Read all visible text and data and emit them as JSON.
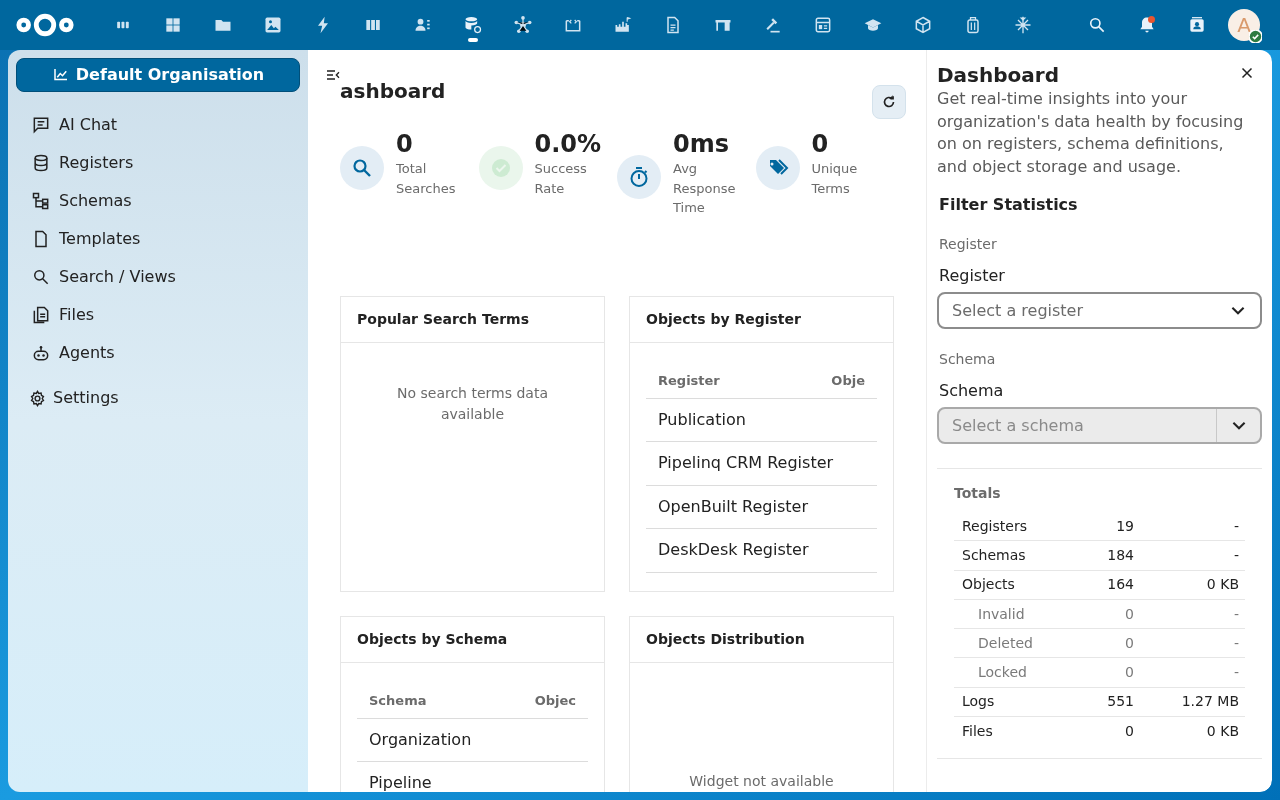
{
  "top_bar": {
    "apps": [
      {
        "selected": false
      },
      {
        "selected": false
      },
      {
        "selected": false
      },
      {
        "selected": false
      },
      {
        "selected": false
      },
      {
        "selected": false
      },
      {
        "selected": false
      },
      {
        "selected": true
      },
      {
        "selected": false
      },
      {
        "selected": false
      },
      {
        "selected": false
      },
      {
        "selected": false
      },
      {
        "selected": false
      },
      {
        "selected": false
      },
      {
        "selected": false
      },
      {
        "selected": false
      },
      {
        "selected": false
      },
      {
        "selected": false
      },
      {
        "selected": false
      }
    ],
    "notifications": {
      "unread": true
    },
    "avatar": {
      "initial": "A",
      "online": true
    }
  },
  "sidebar": {
    "organisation": "Default Organisation",
    "items": [
      {
        "label": "AI Chat",
        "selected": false
      },
      {
        "label": "Registers",
        "selected": false
      },
      {
        "label": "Schemas",
        "selected": false
      },
      {
        "label": "Templates",
        "selected": false
      },
      {
        "label": "Search / Views",
        "selected": false
      },
      {
        "label": "Files",
        "selected": false
      },
      {
        "label": "Agents",
        "selected": false
      }
    ],
    "settings": "Settings"
  },
  "main": {
    "title": "ashboard",
    "stats": [
      {
        "kind": "search",
        "value": "0",
        "label": "Total Searches"
      },
      {
        "kind": "success",
        "value": "0.0%",
        "label": "Success Rate"
      },
      {
        "kind": "timer",
        "value": "0ms",
        "label": "Avg Response Time"
      },
      {
        "kind": "tags",
        "value": "0",
        "label": "Unique Terms"
      }
    ],
    "cards": [
      {
        "kind": "empty",
        "title": "Popular Search Terms",
        "message": "No search terms data available"
      },
      {
        "kind": "table",
        "title": "Objects by Register",
        "columns": [
          "Register",
          "Obje"
        ],
        "rows": [
          "Publication",
          "Pipelinq CRM Register",
          "OpenBuilt Register",
          "DeskDesk Register"
        ]
      },
      {
        "kind": "table",
        "title": "Objects by Schema",
        "columns": [
          "Schema",
          "Objec"
        ],
        "rows": [
          "Organization",
          "Pipeline"
        ]
      },
      {
        "kind": "unavailable",
        "title": "Objects Distribution",
        "message": "Widget not available"
      }
    ]
  },
  "panel": {
    "title": "Dashboard",
    "description": "Get real-time insights into your organization's data health by focusing on on registers, schema definitions, and object storage and usage.",
    "filter_title": "Filter Statistics",
    "filters": [
      {
        "caption": "Register",
        "label": "Register",
        "placeholder": "Select a register",
        "disabled": false
      },
      {
        "caption": "Schema",
        "label": "Schema",
        "placeholder": "Select a schema",
        "disabled": true
      }
    ],
    "totals": {
      "title": "Totals",
      "rows": [
        {
          "kind": "main",
          "label": "Registers",
          "count": "19",
          "size": "-"
        },
        {
          "kind": "main",
          "label": "Schemas",
          "count": "184",
          "size": "-"
        },
        {
          "kind": "main",
          "label": "Objects",
          "count": "164",
          "size": "0 KB"
        },
        {
          "kind": "sub",
          "label": "Invalid",
          "count": "0",
          "size": "-"
        },
        {
          "kind": "sub",
          "label": "Deleted",
          "count": "0",
          "size": "-"
        },
        {
          "kind": "sub",
          "label": "Locked",
          "count": "0",
          "size": "-"
        },
        {
          "kind": "main",
          "label": "Logs",
          "count": "551",
          "size": "1.27 MB"
        },
        {
          "kind": "main",
          "label": "Files",
          "count": "0",
          "size": "0 KB"
        }
      ]
    }
  }
}
